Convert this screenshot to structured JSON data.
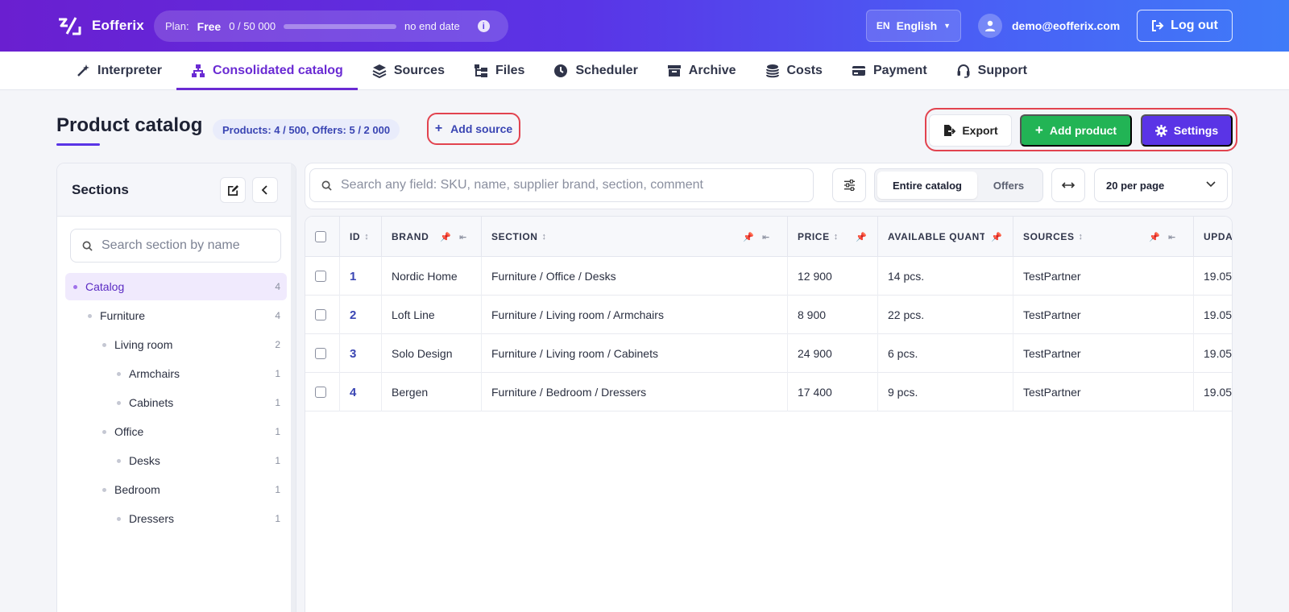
{
  "app": {
    "name": "Eofferix",
    "plan": {
      "label": "Plan:",
      "tier": "Free",
      "usage": "0  /  50 000",
      "fill_fraction": 0.0,
      "end": "no end date",
      "info": "i"
    },
    "language": {
      "code": "EN",
      "name": "English"
    },
    "user": {
      "email": "demo@eofferix.com"
    },
    "logout": "Log out"
  },
  "nav": [
    {
      "label": "Interpreter",
      "icon": "magic-wand-icon"
    },
    {
      "label": "Consolidated catalog",
      "icon": "sitemap-icon",
      "active": true
    },
    {
      "label": "Sources",
      "icon": "layers-icon"
    },
    {
      "label": "Files",
      "icon": "folder-tree-icon"
    },
    {
      "label": "Scheduler",
      "icon": "clock-icon"
    },
    {
      "label": "Archive",
      "icon": "archive-box-icon"
    },
    {
      "label": "Costs",
      "icon": "coins-icon"
    },
    {
      "label": "Payment",
      "icon": "credit-card-icon"
    },
    {
      "label": "Support",
      "icon": "headset-icon"
    }
  ],
  "page": {
    "title": "Product catalog",
    "stats": "Products: 4 / 500, Offers: 5 / 2 000",
    "add_source": "Add source",
    "export": "Export",
    "add_product": "Add product",
    "settings": "Settings"
  },
  "sidebar": {
    "title": "Sections",
    "search_placeholder": "Search section by name",
    "items": [
      {
        "label": "Catalog",
        "count": "4",
        "level": 0,
        "active": true
      },
      {
        "label": "Furniture",
        "count": "4",
        "level": 1
      },
      {
        "label": "Living room",
        "count": "2",
        "level": 2
      },
      {
        "label": "Armchairs",
        "count": "1",
        "level": 3
      },
      {
        "label": "Cabinets",
        "count": "1",
        "level": 3
      },
      {
        "label": "Office",
        "count": "1",
        "level": 2
      },
      {
        "label": "Desks",
        "count": "1",
        "level": 3
      },
      {
        "label": "Bedroom",
        "count": "1",
        "level": 2
      },
      {
        "label": "Dressers",
        "count": "1",
        "level": 3
      }
    ]
  },
  "toolbar": {
    "search_placeholder": "Search any field: SKU, name, supplier brand, section, comment",
    "segments": [
      "Entire catalog",
      "Offers"
    ],
    "per_page": "20 per page"
  },
  "table": {
    "columns": [
      "ID",
      "BRAND",
      "SECTION",
      "PRICE",
      "AVAILABLE QUANTITY",
      "SOURCES",
      "UPDATED"
    ],
    "rows": [
      {
        "id": "1",
        "brand": "Nordic Home",
        "section": "Furniture / Office / Desks",
        "price": "12 900",
        "qty": "14 pcs.",
        "sources": "TestPartner",
        "updated": "19.05"
      },
      {
        "id": "2",
        "brand": "Loft Line",
        "section": "Furniture / Living room / Armchairs",
        "price": "8 900",
        "qty": "22 pcs.",
        "sources": "TestPartner",
        "updated": "19.05"
      },
      {
        "id": "3",
        "brand": "Solo Design",
        "section": "Furniture / Living room / Cabinets",
        "price": "24 900",
        "qty": "6 pcs.",
        "sources": "TestPartner",
        "updated": "19.05"
      },
      {
        "id": "4",
        "brand": "Bergen",
        "section": "Furniture / Bedroom / Dressers",
        "price": "17 400",
        "qty": "9 pcs.",
        "sources": "TestPartner",
        "updated": "19.05"
      }
    ]
  }
}
